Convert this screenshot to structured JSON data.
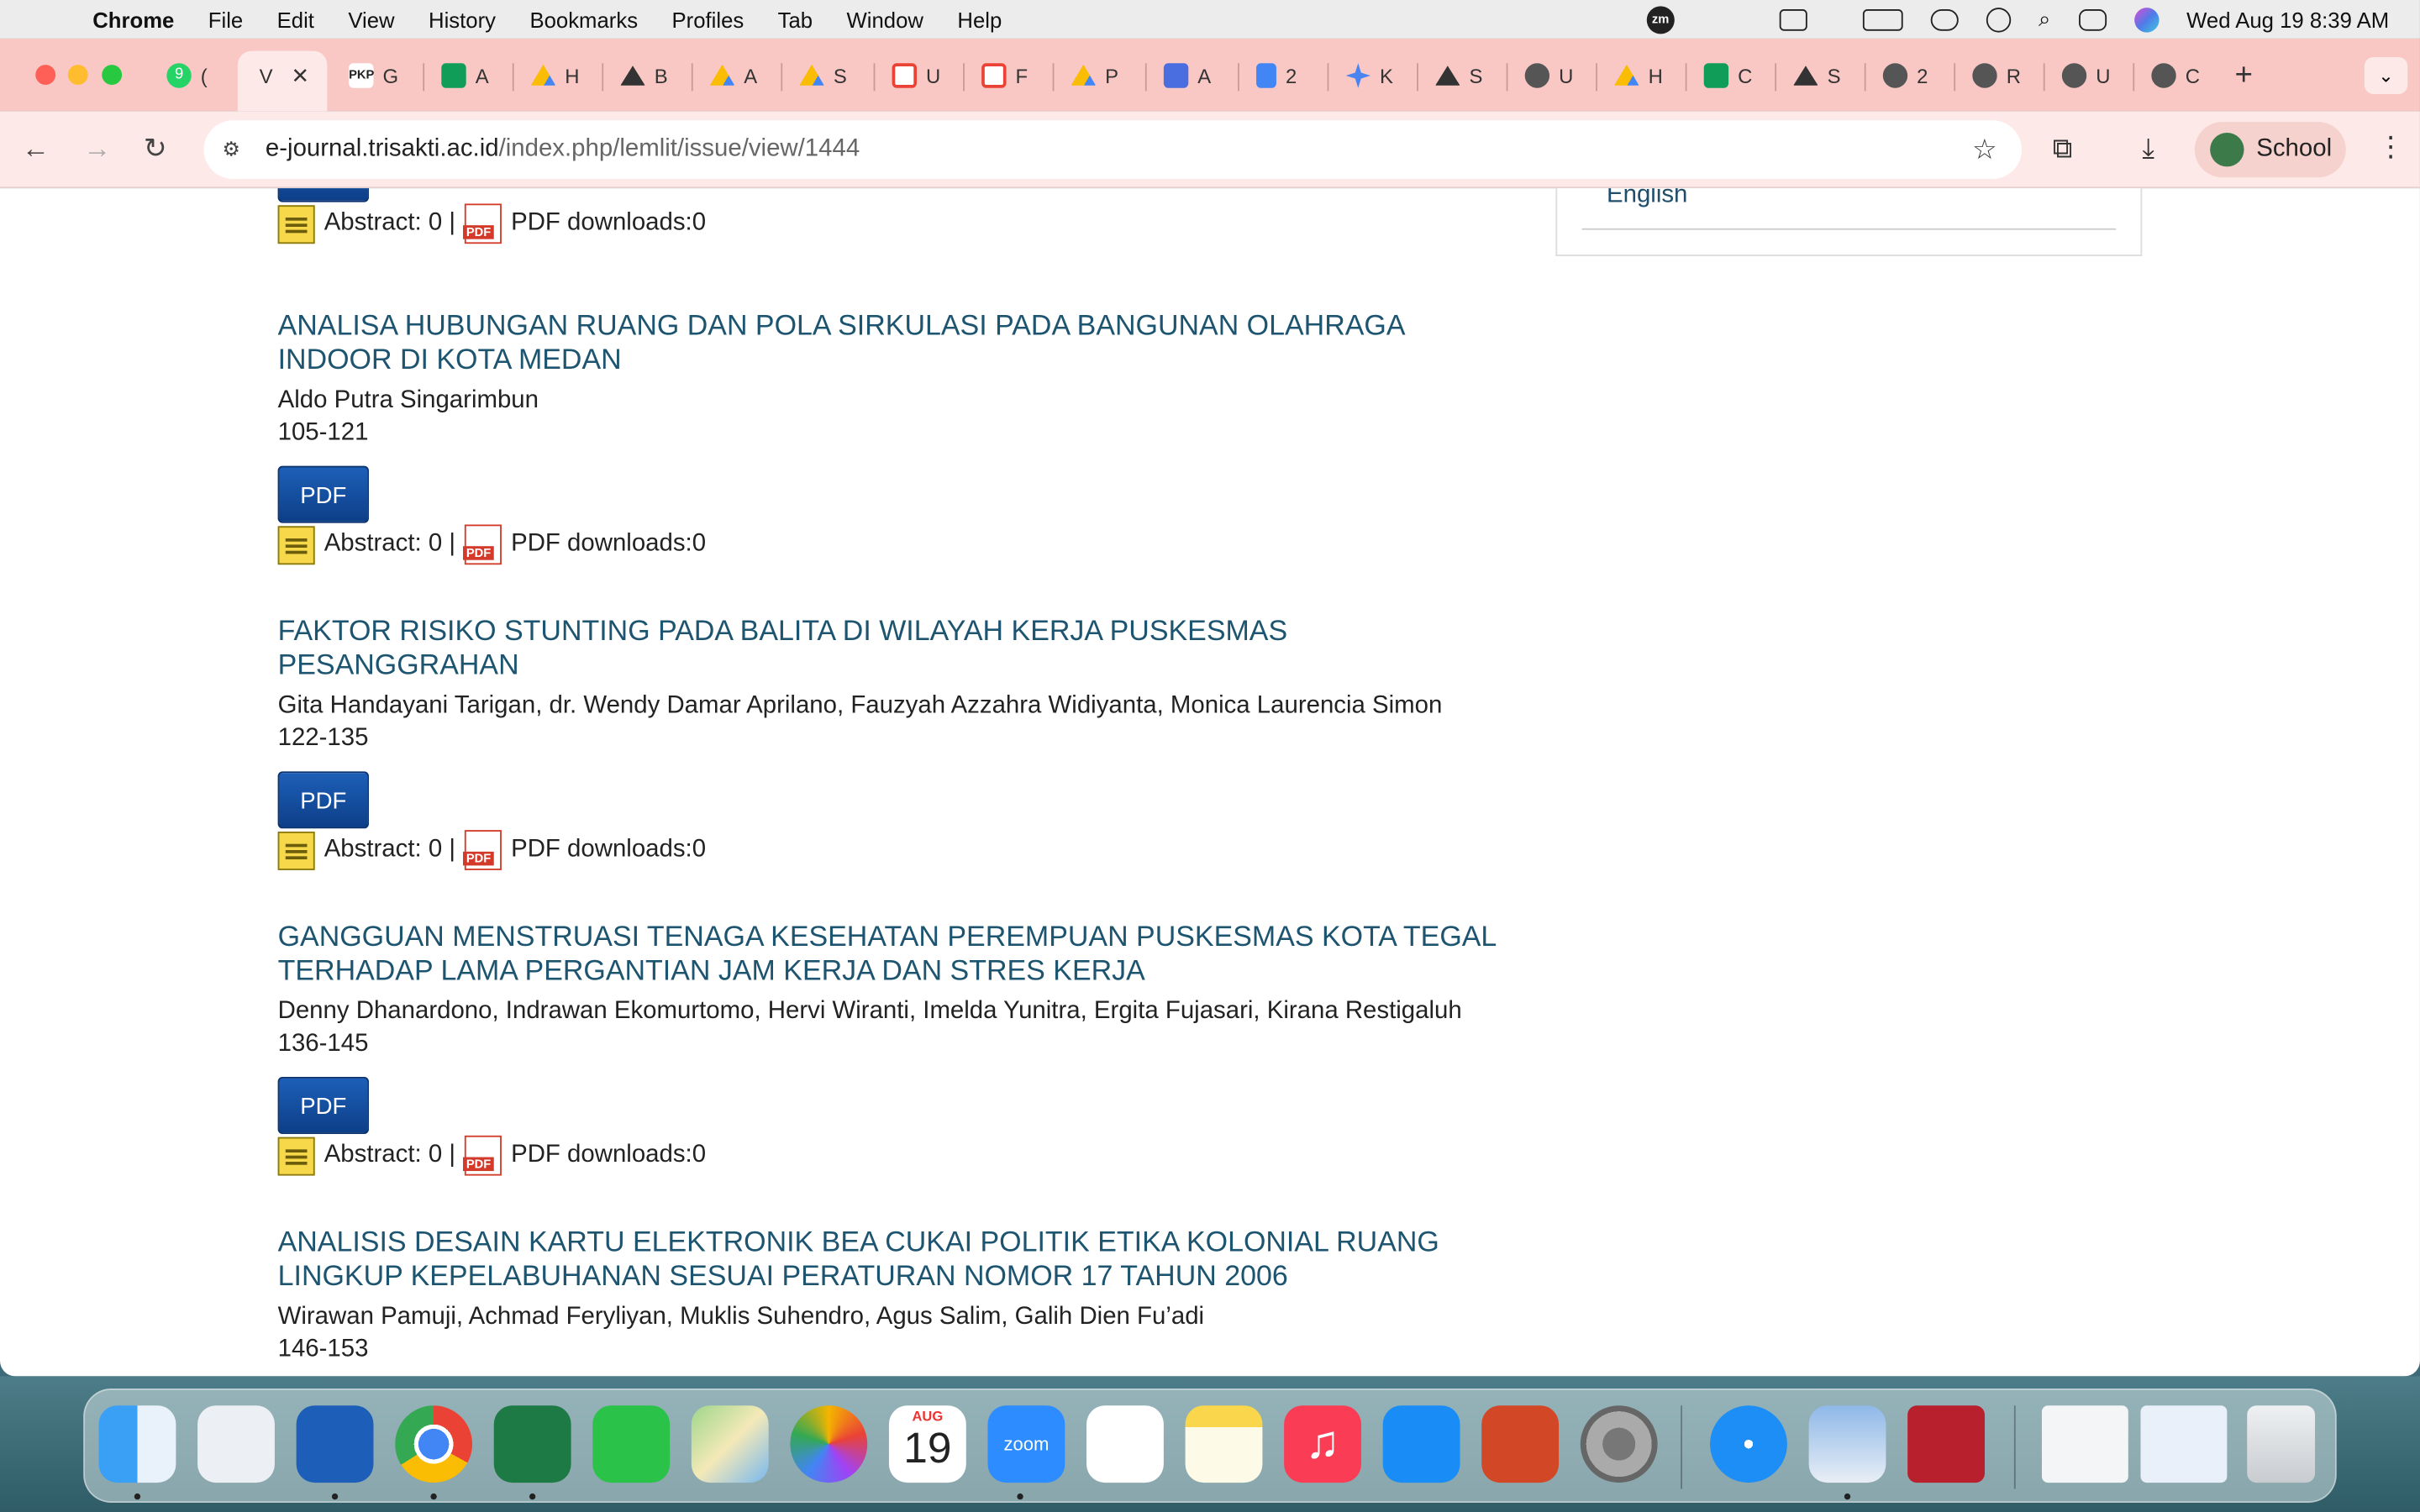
{
  "menubar": {
    "app": "Chrome",
    "items": [
      "File",
      "Edit",
      "View",
      "History",
      "Bookmarks",
      "Profiles",
      "Tab",
      "Window",
      "Help"
    ],
    "clock": "Wed Aug 19  8:39 AM",
    "zoom_label": "zm"
  },
  "tabs": [
    {
      "label": "(",
      "icon": "whatsapp-icon",
      "color": "#25d366"
    },
    {
      "label": "V",
      "icon": "close-icon",
      "active": true
    },
    {
      "label": "G",
      "icon": "pkp-icon",
      "color": "#ffffff"
    },
    {
      "label": "A",
      "icon": "sheets-icon",
      "color": "#0f9d58"
    },
    {
      "label": "H",
      "icon": "drive-icon",
      "color": "#fbbc04"
    },
    {
      "label": "B",
      "icon": "trisakti-icon",
      "color": "#333333"
    },
    {
      "label": "A",
      "icon": "drive-icon",
      "color": "#fbbc04"
    },
    {
      "label": "S",
      "icon": "drive-icon",
      "color": "#fbbc04"
    },
    {
      "label": "U",
      "icon": "gmail-icon",
      "color": "#ea4335"
    },
    {
      "label": "F",
      "icon": "gmail-icon",
      "color": "#ea4335"
    },
    {
      "label": "P",
      "icon": "drive-icon",
      "color": "#fbbc04"
    },
    {
      "label": "A",
      "icon": "ai-icon",
      "color": "#4a6ee0"
    },
    {
      "label": "2",
      "icon": "docs-icon",
      "color": "#4285f4"
    },
    {
      "label": "K",
      "icon": "gemini-icon",
      "color": "#4a84f0"
    },
    {
      "label": "S",
      "icon": "trisakti-icon",
      "color": "#333333"
    },
    {
      "label": "U",
      "icon": "globe-icon",
      "color": "#555555"
    },
    {
      "label": "H",
      "icon": "drive-icon",
      "color": "#fbbc04"
    },
    {
      "label": "C",
      "icon": "sheets-icon",
      "color": "#0f9d58"
    },
    {
      "label": "S",
      "icon": "trisakti-icon",
      "color": "#333333"
    },
    {
      "label": "2",
      "icon": "globe-icon",
      "color": "#555555"
    },
    {
      "label": "R",
      "icon": "globe-icon",
      "color": "#555555"
    },
    {
      "label": "U",
      "icon": "globe-icon",
      "color": "#555555"
    },
    {
      "label": "C",
      "icon": "globe-icon",
      "color": "#555555"
    }
  ],
  "toolbar": {
    "url_host": "e-journal.trisakti.ac.id",
    "url_path": "/index.php/lemlit/issue/view/1444",
    "profile_label": "School"
  },
  "sidebar": {
    "language": "English"
  },
  "stats_labels": {
    "abstract": "Abstract: 0 |",
    "pdf_downloads": "PDF downloads:0",
    "pdf_button": "PDF",
    "pdf_icon_text": "PDF"
  },
  "articles": [
    {
      "title": "ANALISA HUBUNGAN RUANG DAN POLA SIRKULASI PADA BANGUNAN OLAHRAGA INDOOR DI KOTA MEDAN",
      "authors": "Aldo Putra Singarimbun",
      "pages": "105-121"
    },
    {
      "title": "FAKTOR RISIKO STUNTING PADA BALITA DI WILAYAH KERJA PUSKESMAS PESANGGRAHAN",
      "authors": "Gita Handayani Tarigan, dr. Wendy Damar Aprilano, Fauzyah Azzahra Widiyanta, Monica Laurencia Simon",
      "pages": "122-135"
    },
    {
      "title": "GANGGUAN MENSTRUASI TENAGA KESEHATAN PEREMPUAN PUSKESMAS KOTA TEGAL TERHADAP LAMA PERGANTIAN JAM KERJA DAN STRES KERJA",
      "authors": "Denny Dhanardono, Indrawan Ekomurtomo, Hervi Wiranti, Imelda Yunitra, Ergita Fujasari, Kirana Restigaluh",
      "pages": "136-145"
    },
    {
      "title": "ANALISIS DESAIN KARTU ELEKTRONIK BEA CUKAI POLITIK ETIKA KOLONIAL RUANG LINGKUP KEPELABUHANAN SESUAI PERATURAN NOMOR 17 TAHUN 2006",
      "authors": "Wirawan Pamuji, Achmad Feryliyan, Muklis Suhendro, Agus Salim, Galih Dien Fu’adi",
      "pages": "146-153"
    }
  ],
  "dock": {
    "calendar_month": "AUG",
    "calendar_day": "19",
    "zoom_label": "zoom",
    "apps": [
      "finder-icon",
      "launchpad-icon",
      "word-icon",
      "chrome-icon",
      "excel-icon",
      "facetime-icon",
      "maps-icon",
      "photos-icon",
      "calendar-icon",
      "zoom-icon",
      "reminders-icon",
      "notes-icon",
      "music-icon",
      "app-store-icon",
      "powerpoint-icon",
      "system-settings-icon",
      "safari-icon",
      "preview-icon",
      "mendeley-icon",
      "excel-window-icon",
      "word-window-icon",
      "trash-icon"
    ]
  }
}
